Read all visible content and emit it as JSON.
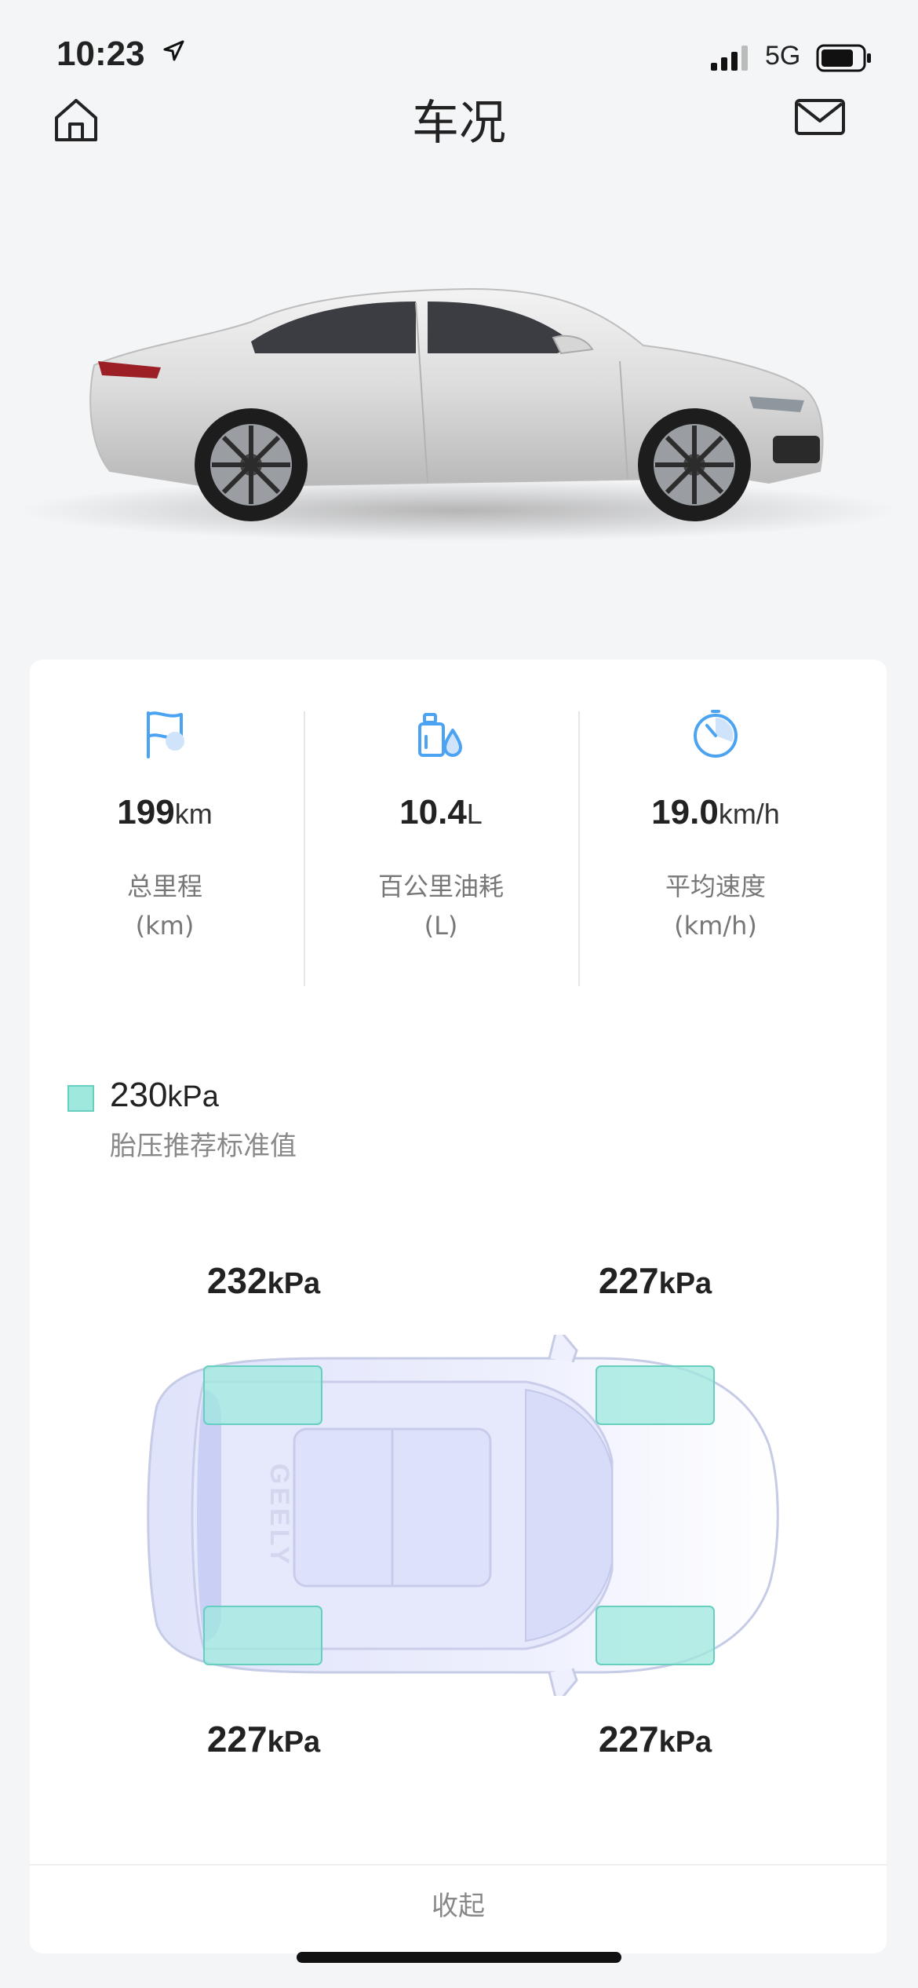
{
  "status_bar": {
    "time": "10:23",
    "network": "5G"
  },
  "nav": {
    "title": "车况"
  },
  "stats": [
    {
      "value": "199",
      "unit": "km",
      "label": "总里程",
      "sub": "(km)"
    },
    {
      "value": "10.4",
      "unit": "L",
      "label": "百公里油耗",
      "sub": "(L)"
    },
    {
      "value": "19.0",
      "unit": "km/h",
      "label": "平均速度",
      "sub": "(km/h)"
    }
  ],
  "tire_legend": {
    "value": "230",
    "unit": "kPa",
    "label": "胎压推荐标准值",
    "color": "#9ee8dd"
  },
  "tires": {
    "front_left": {
      "value": "232",
      "unit": "kPa"
    },
    "front_right": {
      "value": "227",
      "unit": "kPa"
    },
    "rear_left": {
      "value": "227",
      "unit": "kPa"
    },
    "rear_right": {
      "value": "227",
      "unit": "kPa"
    }
  },
  "car_logo_text": "GEELY",
  "footer": {
    "collapse_label": "收起"
  },
  "colors": {
    "accent": "#4ba3f2",
    "tire_fill": "#9ee8dd",
    "background": "#f4f5f7"
  }
}
